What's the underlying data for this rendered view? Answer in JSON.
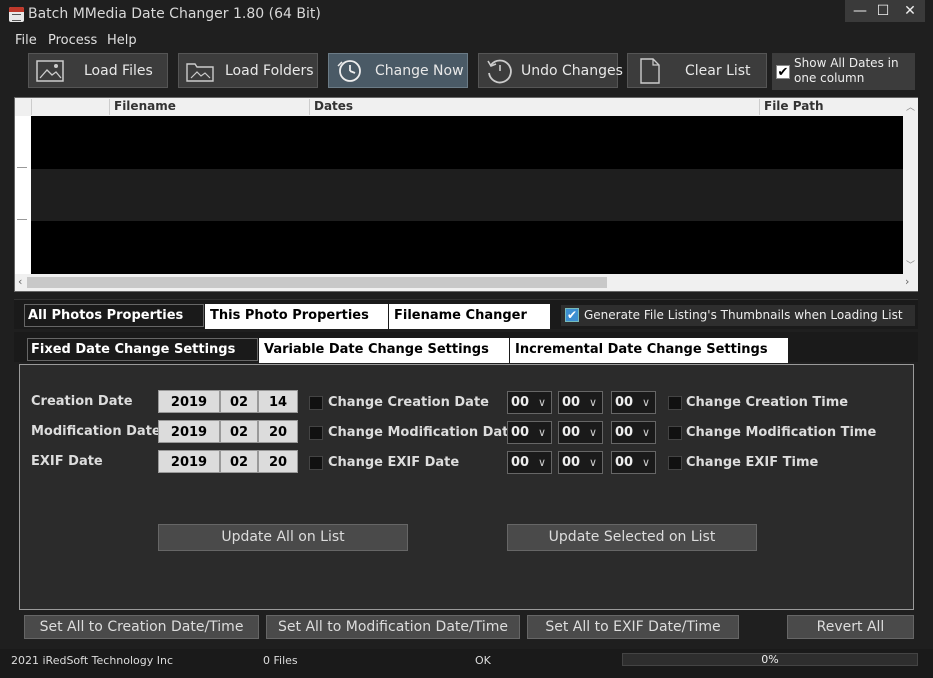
{
  "window": {
    "title": "Batch MMedia Date Changer 1.80 (64 Bit)",
    "minimize": "—",
    "maximize": "☐",
    "close": "✕"
  },
  "menu": [
    "File",
    "Process",
    "Help"
  ],
  "toolbar": {
    "load_files": "Load Files",
    "load_folders": "Load Folders",
    "change_now": "Change Now",
    "undo_changes": "Undo Changes",
    "clear_list": "Clear List",
    "show_all_dates": "Show All Dates in one column",
    "show_all_checked": true
  },
  "list": {
    "columns": [
      "Filename",
      "Dates",
      "File Path"
    ]
  },
  "tabs_main": {
    "all_photos": "All Photos Properties",
    "this_photo": "This Photo Properties",
    "filename_changer": "Filename Changer"
  },
  "generate_thumbs": {
    "label": "Generate File Listing's Thumbnails when Loading List",
    "checked": true
  },
  "tabs_sub": {
    "fixed": "Fixed Date Change Settings",
    "variable": "Variable Date Change Settings",
    "incremental": "Incremental Date Change Settings"
  },
  "rows": [
    {
      "label": "Creation Date",
      "year": "2019",
      "month": "02",
      "day": "14",
      "change_date": "Change Creation Date",
      "hh": "00",
      "mm": "00",
      "ss": "00",
      "change_time": "Change Creation Time"
    },
    {
      "label": "Modification Date",
      "year": "2019",
      "month": "02",
      "day": "20",
      "change_date": "Change Modification Date",
      "hh": "00",
      "mm": "00",
      "ss": "00",
      "change_time": "Change Modification Time"
    },
    {
      "label": "EXIF Date",
      "year": "2019",
      "month": "02",
      "day": "20",
      "change_date": "Change EXIF Date",
      "hh": "00",
      "mm": "00",
      "ss": "00",
      "change_time": "Change EXIF Time"
    }
  ],
  "update_all": "Update All on List",
  "update_selected": "Update Selected on List",
  "bottom": {
    "set_creation": "Set All to Creation Date/Time",
    "set_modification": "Set All to Modification Date/Time",
    "set_exif": "Set All to EXIF Date/Time",
    "revert_all": "Revert All"
  },
  "status": {
    "company": "2021 iRedSoft Technology Inc",
    "files": "0 Files",
    "state": "OK",
    "progress": "0%"
  }
}
